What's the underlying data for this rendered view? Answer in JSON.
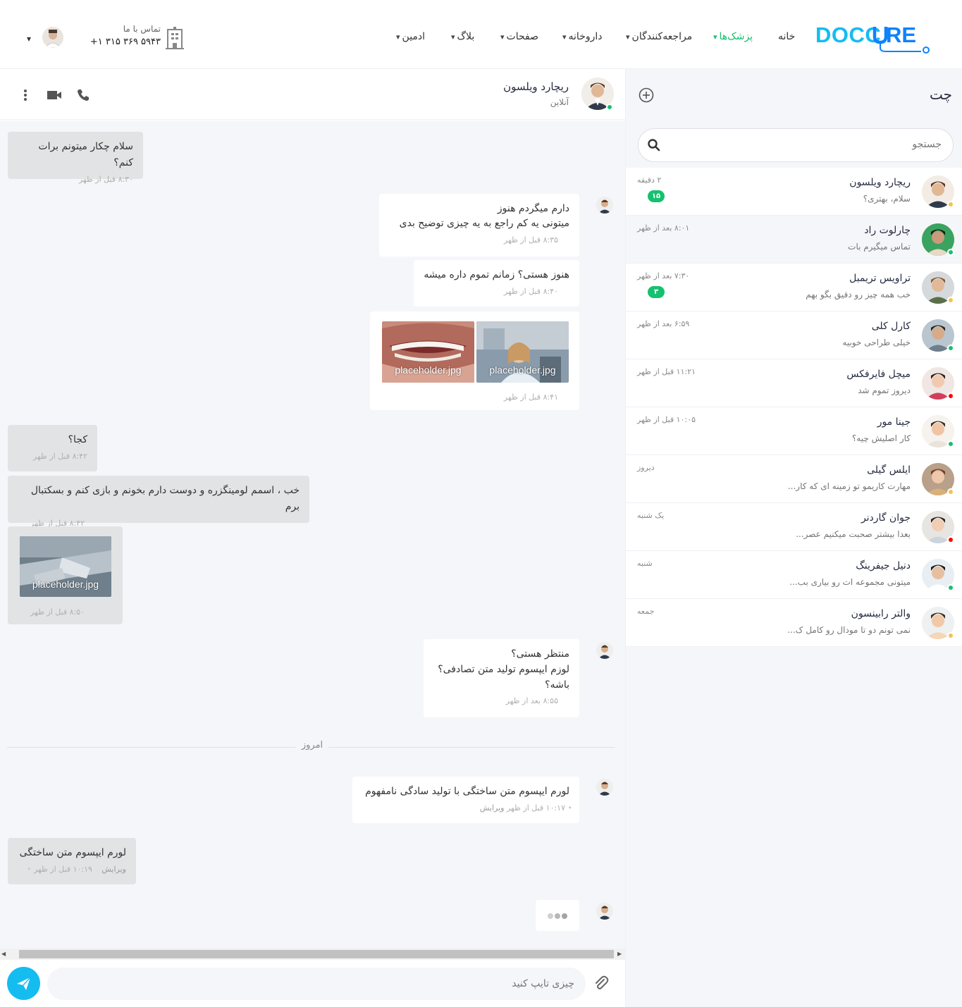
{
  "brand": {
    "logo_text": "DOCCURE",
    "color_primary": "#15bcf0",
    "color_dark": "#0e82fd",
    "color_green": "#15c16f"
  },
  "nav": [
    {
      "label": "خانه",
      "active": false
    },
    {
      "label": "پزشک‌ها",
      "active": true
    },
    {
      "label": "مراجعه‌کنندگان",
      "active": false
    },
    {
      "label": "داروخانه",
      "active": false
    },
    {
      "label": "صفحات",
      "active": false
    },
    {
      "label": "بلاگ",
      "active": false
    },
    {
      "label": "ادمین",
      "active": false
    }
  ],
  "contact": {
    "label": "تماس با ما",
    "phone": "+۱ ۳۱۵ ۳۶۹ ۵۹۴۳",
    "icon": "hospital-icon"
  },
  "sidebar": {
    "title": "چت",
    "search_placeholder": "جستجو",
    "contacts": [
      {
        "name": "ریچارد ویلسون",
        "preview": "سلام، بهتری؟",
        "time": "۲ دقیقه",
        "badge": "۱۵",
        "status": "away"
      },
      {
        "name": "چارلوت راد",
        "preview": "تماس میگیرم بات",
        "time": "۸:۰۱ بعد از ظهر",
        "badge": "",
        "status": "online"
      },
      {
        "name": "تراویس تریمبل",
        "preview": "خب همه چیز رو دقیق بگو بهم",
        "time": "۷:۳۰ بعد از ظهر",
        "badge": "۳",
        "status": "away"
      },
      {
        "name": "کارل کلی",
        "preview": "خیلی طراحی خوبیه",
        "time": "۶:۵۹ بعد از ظهر",
        "badge": "",
        "status": "online"
      },
      {
        "name": "میچل فایرفکس",
        "preview": "دیروز تموم شد",
        "time": "۱۱:۲۱ قبل از ظهر",
        "badge": "",
        "status": "offline"
      },
      {
        "name": "جینا مور",
        "preview": "کار اصلیش چیه؟",
        "time": "۱۰:۰۵ قبل از ظهر",
        "badge": "",
        "status": "online"
      },
      {
        "name": "ایلس گیلی",
        "preview": "مهارت کاریمو تو زمینه ای که کار...",
        "time": "دیروز",
        "badge": "",
        "status": "away"
      },
      {
        "name": "جوان گاردنر",
        "preview": "بعدا بیشتر صحبت میکنیم عصر...",
        "time": "یک شنبه",
        "badge": "",
        "status": "offline"
      },
      {
        "name": "دنیل جیفرینگ",
        "preview": "میتونی مجموعه ات رو بیاری بب...",
        "time": "شنبه",
        "badge": "",
        "status": "online"
      },
      {
        "name": "والتر رابینسون",
        "preview": "نمی تونم دو تا مودال رو کامل ک...",
        "time": "جمعه",
        "badge": "",
        "status": "away"
      }
    ]
  },
  "status_colors": {
    "online": "#15c16f",
    "away": "#f4c150",
    "offline": "#ff0100"
  },
  "chat": {
    "name": "ریچارد ویلسون",
    "status": "آنلاین",
    "messages": [
      {
        "dir": "out",
        "lines": [
          "سلام چکار میتونم برات کنم؟"
        ],
        "time": "۸:۳۰ قبل از ظهر"
      },
      {
        "dir": "in",
        "lines": [
          "دارم میگردم هنوز",
          "میتونی یه کم راجع به یه چیزی توضیح بدی"
        ],
        "time": "۸:۳۵ قبل از ظهر"
      },
      {
        "dir": "in",
        "lines": [
          "هنوز هستی؟ زمانم تموم داره میشه"
        ],
        "time": "۸:۴۰ قبل از ظهر"
      },
      {
        "dir": "in",
        "images": [
          "placeholder.jpg",
          "placeholder.jpg"
        ],
        "time": "۸:۴۱ قبل از ظهر"
      },
      {
        "dir": "out",
        "lines": [
          "کجا؟"
        ],
        "time": "۸:۴۲ قبل از ظهر"
      },
      {
        "dir": "out",
        "lines": [
          "خب ، اسمم لومینگزره و دوست دارم بخونم و بازی کنم و بسکتبال برم"
        ],
        "time": "۸:۴۲ قبل از ظهر"
      },
      {
        "dir": "out",
        "images": [
          "placeholder.jpg"
        ],
        "time": "۸:۵۰ قبل از ظهر"
      },
      {
        "dir": "in",
        "lines": [
          "منتظر هستی؟",
          "لوزم ایپسوم تولید متن تصادفی؟",
          "باشه؟"
        ],
        "time": "۸:۵۵ بعد از ظهر"
      },
      {
        "dir": "in",
        "lines": [
          "لورم ایپسوم متن ساختگی با تولید سادگی نامفهوم"
        ],
        "time": "۱۰:۱۷ قبل از ظهر",
        "edit": "ویرایش"
      },
      {
        "dir": "out",
        "lines": [
          "لورم ایپسوم متن ساختگی"
        ],
        "time": "۱۰:۱۹ قبل از ظهر",
        "edit": "ویرایش"
      }
    ],
    "divider": "امروز",
    "input_placeholder": "چیزی تایپ کنید"
  }
}
